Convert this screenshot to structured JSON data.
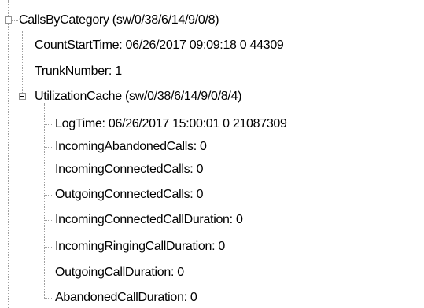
{
  "tree": {
    "root": {
      "label": "CallsByCategory (sw/0/38/6/14/9/0/8)",
      "expanded": true,
      "children": {
        "count_start_time": "CountStartTime: 06/26/2017 09:09:18 0 44309",
        "trunk_number": "TrunkNumber: 1",
        "utilization_cache": {
          "label": "UtilizationCache (sw/0/38/6/14/9/0/8/4)",
          "expanded": true,
          "items": [
            "LogTime: 06/26/2017 15:00:01 0 21087309",
            "IncomingAbandonedCalls: 0",
            "IncomingConnectedCalls: 0",
            "OutgoingConnectedCalls: 0",
            "IncomingConnectedCallDuration: 0",
            "IncomingRingingCallDuration: 0",
            "OutgoingCallDuration: 0",
            "AbandonedCallDuration: 0"
          ]
        }
      }
    }
  },
  "colors": {
    "connector": "#a0a0a0",
    "expander_border": "#919191",
    "text": "#000000"
  }
}
